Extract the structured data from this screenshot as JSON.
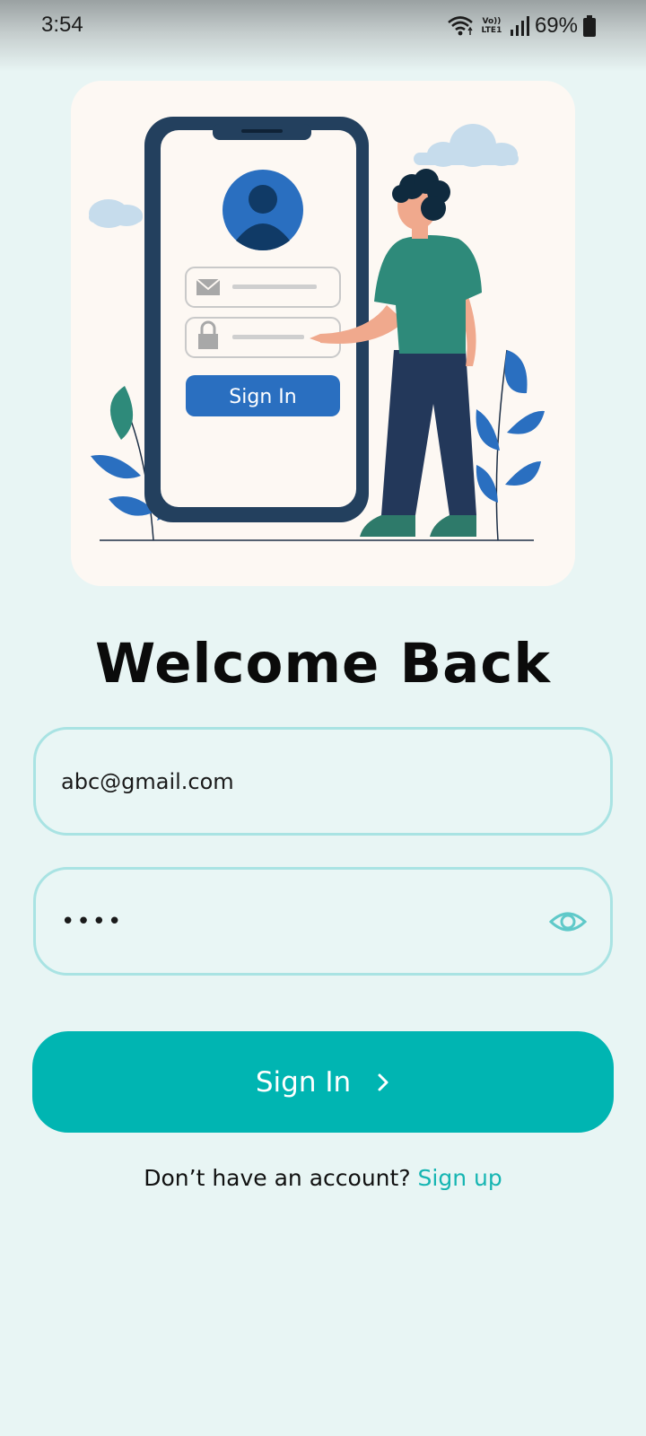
{
  "status_bar": {
    "time": "3:54",
    "volte": "Vo)) LTE1",
    "battery_percent": "69%",
    "icons": [
      "wifi-icon",
      "signal-icon",
      "battery-icon"
    ]
  },
  "hero": {
    "illustration": "person-pointing-at-phone-login",
    "phone_button_label": "Sign In"
  },
  "title": "Welcome Back",
  "email": {
    "value": "abc@gmail.com",
    "placeholder": ""
  },
  "password": {
    "value": "••••",
    "icon": "eye-icon"
  },
  "signin_button": {
    "label": "Sign In",
    "icon": "chevron-right-icon"
  },
  "signup": {
    "prompt": "Don’t have an account? ",
    "link": "Sign up"
  },
  "colors": {
    "background": "#e8f5f4",
    "accent": "#00b5b2",
    "field_border": "#a9e3e3",
    "link": "#16b5b2"
  }
}
